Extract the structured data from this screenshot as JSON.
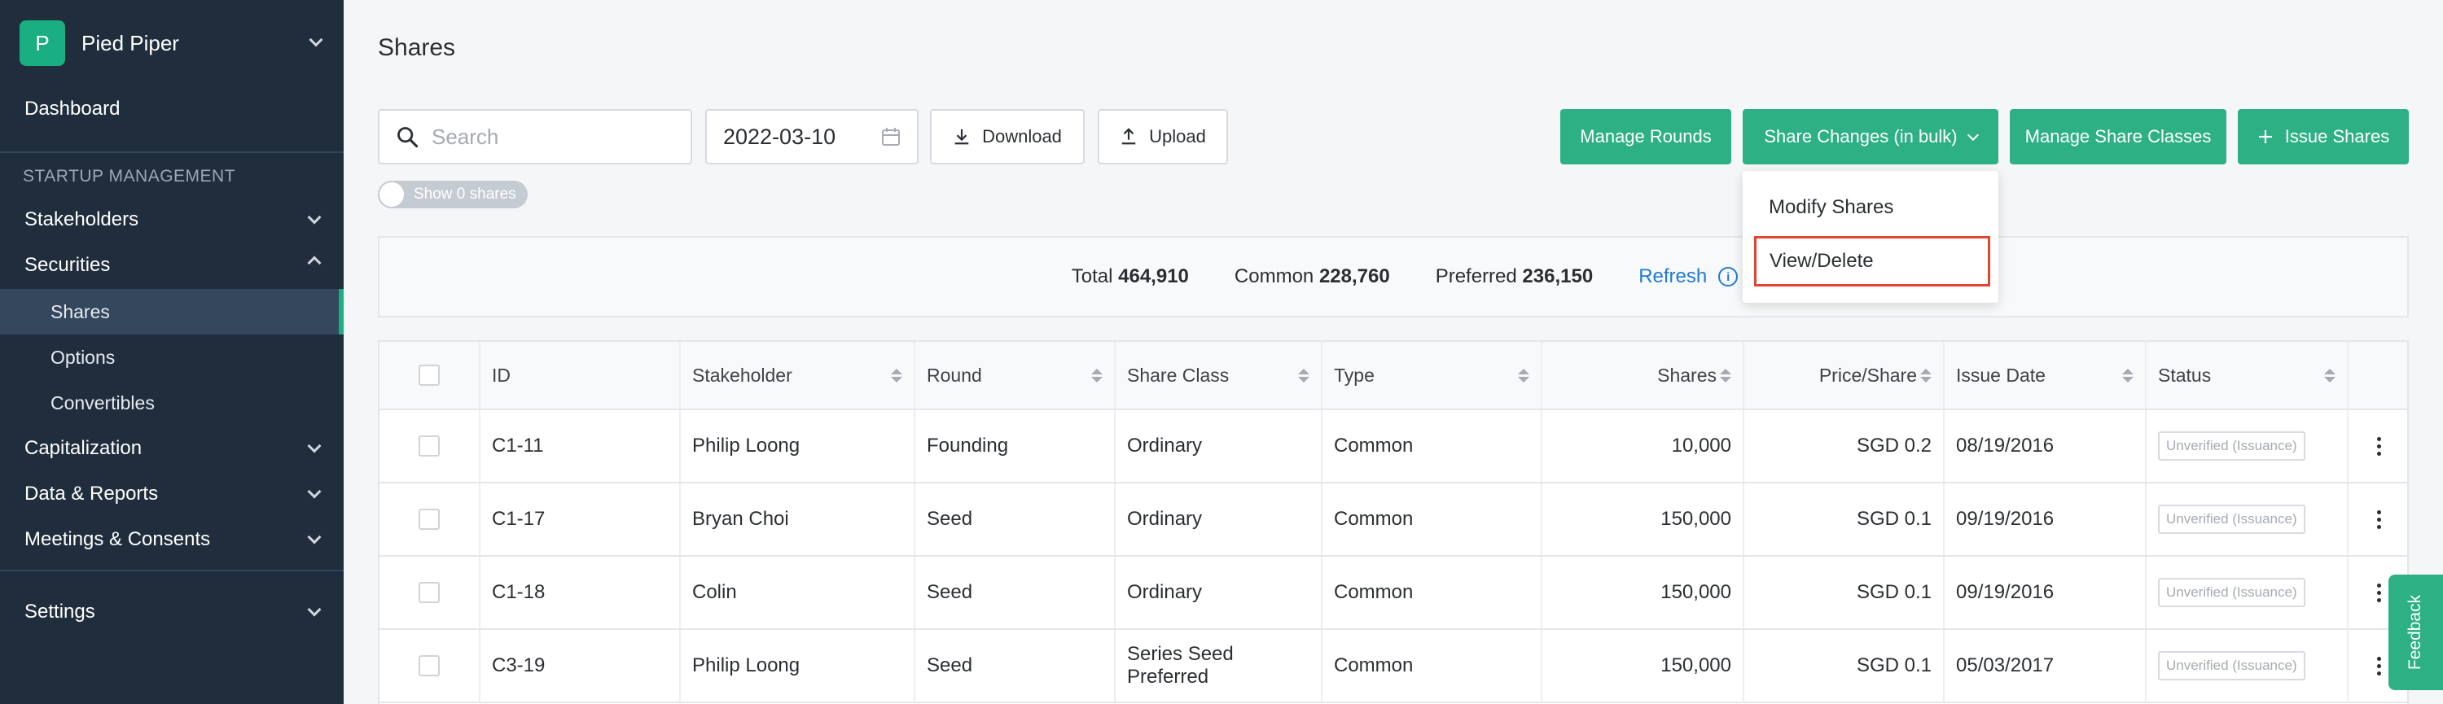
{
  "sidebar": {
    "company_initial": "P",
    "company_name": "Pied Piper",
    "dashboard": "Dashboard",
    "section_title": "STARTUP MANAGEMENT",
    "items": [
      {
        "label": "Stakeholders"
      },
      {
        "label": "Securities"
      },
      {
        "label": "Capitalization"
      },
      {
        "label": "Data & Reports"
      },
      {
        "label": "Meetings & Consents"
      },
      {
        "label": "Settings"
      }
    ],
    "sub_items": [
      {
        "label": "Shares"
      },
      {
        "label": "Options"
      },
      {
        "label": "Convertibles"
      }
    ]
  },
  "page": {
    "title": "Shares"
  },
  "toolbar": {
    "search_placeholder": "Search",
    "date_value": "2022-03-10",
    "download_label": "Download",
    "upload_label": "Upload",
    "show_zero_label": "Show 0 shares",
    "manage_rounds_label": "Manage Rounds",
    "share_changes_label": "Share Changes (in bulk)",
    "manage_share_classes_label": "Manage Share Classes",
    "issue_shares_label": "Issue Shares"
  },
  "dropdown": {
    "items": [
      {
        "label": "Modify Shares"
      },
      {
        "label": "View/Delete"
      }
    ]
  },
  "summary": {
    "total_label": "Total",
    "total_value": "464,910",
    "common_label": "Common",
    "common_value": "228,760",
    "preferred_label": "Preferred",
    "preferred_value": "236,150",
    "refresh_label": "Refresh"
  },
  "table": {
    "headers": {
      "id": "ID",
      "stakeholder": "Stakeholder",
      "round": "Round",
      "share_class": "Share Class",
      "type": "Type",
      "shares": "Shares",
      "price": "Price/Share",
      "issue_date": "Issue Date",
      "status": "Status"
    },
    "rows": [
      {
        "id": "C1-11",
        "stakeholder": "Philip Loong",
        "round": "Founding",
        "share_class": "Ordinary",
        "type": "Common",
        "shares": "10,000",
        "price": "SGD 0.2",
        "issue_date": "08/19/2016",
        "status": "Unverified (Issuance)"
      },
      {
        "id": "C1-17",
        "stakeholder": "Bryan Choi",
        "round": "Seed",
        "share_class": "Ordinary",
        "type": "Common",
        "shares": "150,000",
        "price": "SGD 0.1",
        "issue_date": "09/19/2016",
        "status": "Unverified (Issuance)"
      },
      {
        "id": "C1-18",
        "stakeholder": "Colin",
        "round": "Seed",
        "share_class": "Ordinary",
        "type": "Common",
        "shares": "150,000",
        "price": "SGD 0.1",
        "issue_date": "09/19/2016",
        "status": "Unverified (Issuance)"
      },
      {
        "id": "C3-19",
        "stakeholder": "Philip Loong",
        "round": "Seed",
        "share_class": "Series Seed Preferred",
        "type": "Common",
        "shares": "150,000",
        "price": "SGD 0.1",
        "issue_date": "05/03/2017",
        "status": "Unverified (Issuance)"
      }
    ]
  },
  "feedback_label": "Feedback",
  "colors": {
    "sidebar_bg": "#1f2d3d",
    "accent_green": "#2eb085",
    "link_blue": "#1e7bd0",
    "highlight_red": "#e0452f"
  }
}
